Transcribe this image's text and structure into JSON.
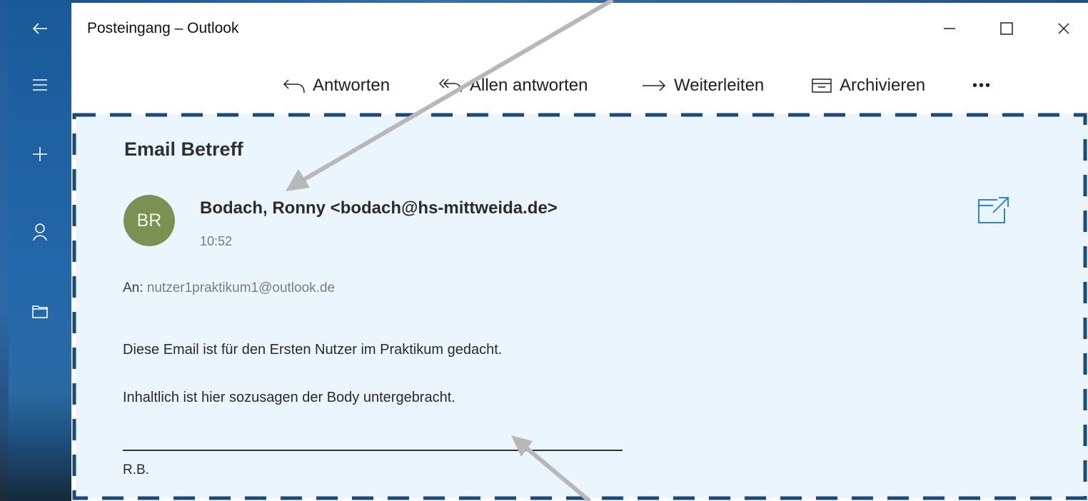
{
  "window": {
    "title": "Posteingang – Outlook",
    "controls": [
      "minimize",
      "maximize",
      "close"
    ]
  },
  "rail": {
    "items": [
      {
        "name": "back",
        "icon": "arrow-left-icon"
      },
      {
        "name": "menu",
        "icon": "hamburger-icon"
      },
      {
        "name": "new-mail",
        "icon": "plus-icon"
      },
      {
        "name": "people",
        "icon": "person-icon"
      },
      {
        "name": "folders",
        "icon": "folder-icon"
      }
    ]
  },
  "toolbar": {
    "reply_label": "Antworten",
    "reply_all_label": "Allen antworten",
    "forward_label": "Weiterleiten",
    "archive_label": "Archivieren",
    "more_label": "•••"
  },
  "message": {
    "subject": "Email Betreff",
    "avatar_initials": "BR",
    "avatar_color": "#7b9153",
    "sender": "Bodach, Ronny <bodach@hs-mittweida.de>",
    "time": "10:52",
    "to_label": "An:",
    "to_address": "nutzer1praktikum1@outlook.de",
    "body": [
      "Diese Email ist für den Ersten Nutzer im Praktikum gedacht.",
      "Inhaltlich ist hier sozusagen der Body untergebracht."
    ],
    "signature": "R.B."
  },
  "colors": {
    "rail": "#2368aa",
    "pane_background": "#eaf5fd",
    "dashed_border": "#1b4a78",
    "accent": "#2b88d8",
    "annotation_arrow": "#b8b8b8"
  }
}
